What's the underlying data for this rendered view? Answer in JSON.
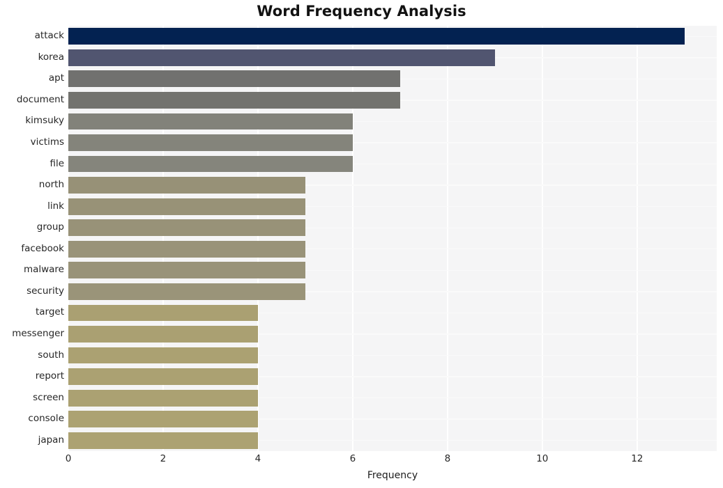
{
  "chart_data": {
    "type": "bar",
    "orientation": "horizontal",
    "title": "Word Frequency Analysis",
    "xlabel": "Frequency",
    "ylabel": "",
    "categories": [
      "attack",
      "korea",
      "apt",
      "document",
      "kimsuky",
      "victims",
      "file",
      "north",
      "link",
      "group",
      "facebook",
      "malware",
      "security",
      "target",
      "messenger",
      "south",
      "report",
      "screen",
      "console",
      "japan"
    ],
    "values": [
      13,
      9,
      7,
      7,
      6,
      6,
      6,
      5,
      5,
      5,
      5,
      5,
      5,
      4,
      4,
      4,
      4,
      4,
      4,
      4
    ],
    "xlim": [
      0,
      13.68
    ],
    "xticks": [
      0,
      2,
      4,
      6,
      8,
      10,
      12
    ],
    "xticklabels": [
      "0",
      "2",
      "4",
      "6",
      "8",
      "10",
      "12"
    ],
    "grid": true,
    "grid_color": "#ffffff",
    "legend": "none",
    "plot_background": "#f5f5f6",
    "figure_background": "#ffffff",
    "bar_colors": [
      "#032251",
      "#515570",
      "#71716f",
      "#73736f",
      "#82827a",
      "#84847b",
      "#85857c",
      "#979177",
      "#989277",
      "#989278",
      "#999379",
      "#999379",
      "#9a9479",
      "#aaa072",
      "#aaa072",
      "#aba172",
      "#aba172",
      "#aba172",
      "#aca272",
      "#aca272"
    ]
  }
}
